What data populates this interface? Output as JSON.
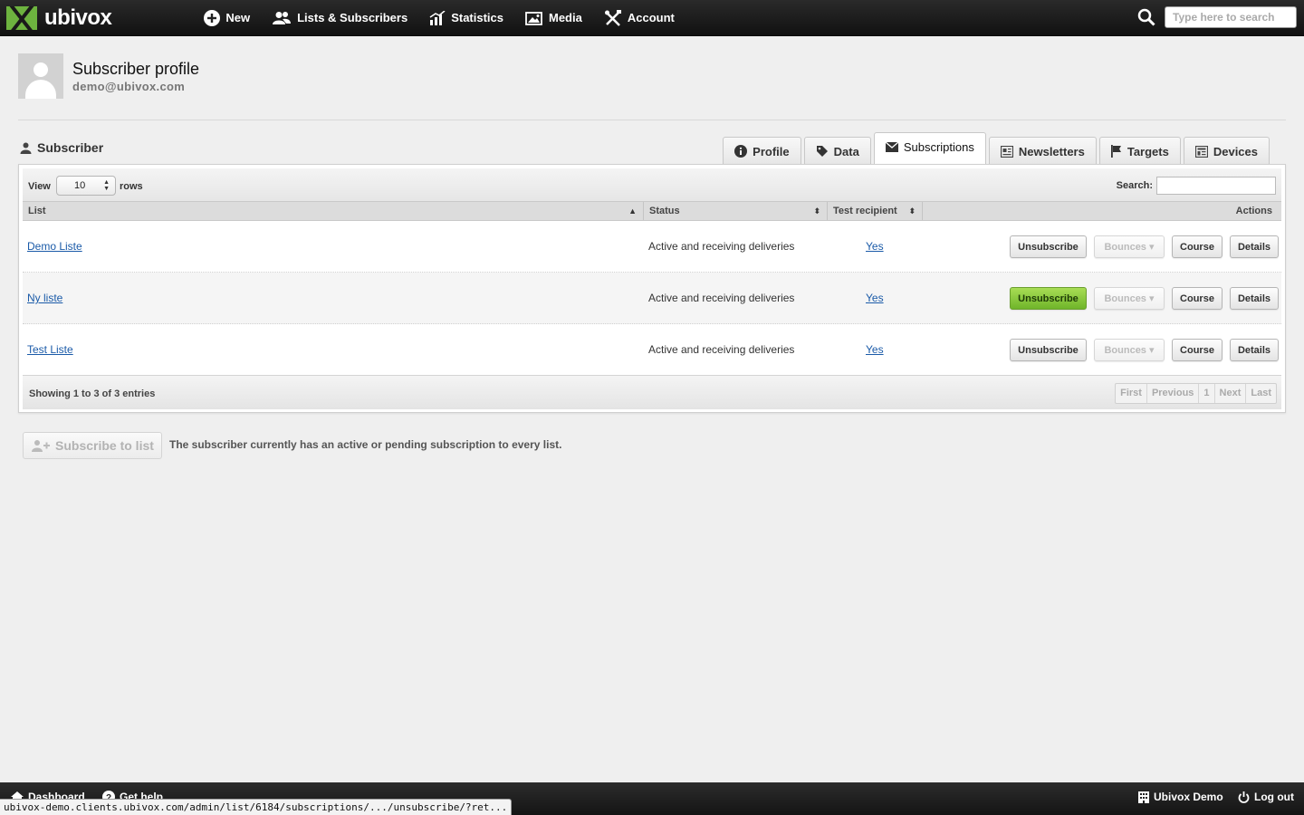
{
  "app": {
    "name": "ubivox"
  },
  "nav": {
    "new": "New",
    "lists": "Lists & Subscribers",
    "statistics": "Statistics",
    "media": "Media",
    "account": "Account"
  },
  "search": {
    "placeholder": "Type here to search"
  },
  "profile": {
    "title": "Subscriber profile",
    "email": "demo@ubivox.com"
  },
  "section": {
    "label": "Subscriber"
  },
  "tabs": [
    "Profile",
    "Data",
    "Subscriptions",
    "Newsletters",
    "Targets",
    "Devices"
  ],
  "active_tab": "Subscriptions",
  "table": {
    "view_label": "View",
    "rows_value": "10",
    "rows_label": "rows",
    "search_label": "Search:",
    "columns": [
      "List",
      "Status",
      "Test recipient",
      "Actions"
    ],
    "rows": [
      {
        "list": "Demo Liste",
        "status": "Active and receiving deliveries",
        "test": "Yes"
      },
      {
        "list": "Ny liste",
        "status": "Active and receiving deliveries",
        "test": "Yes"
      },
      {
        "list": "Test Liste",
        "status": "Active and receiving deliveries",
        "test": "Yes"
      }
    ],
    "actions": {
      "unsubscribe": "Unsubscribe",
      "bounces": "Bounces",
      "course": "Course",
      "details": "Details"
    },
    "info": "Showing 1 to 3 of 3 entries",
    "pager": [
      "First",
      "Previous",
      "1",
      "Next",
      "Last"
    ]
  },
  "subscribe": {
    "button": "Subscribe to list",
    "note": "The subscriber currently has an active or pending subscription to every list."
  },
  "bottom": {
    "dashboard": "Dashboard",
    "help": "Get help",
    "account_name": "Ubivox Demo",
    "logout": "Log out"
  },
  "status_url": "ubivox-demo.clients.ubivox.com/admin/list/6184/subscriptions/.../unsubscribe/?ret...",
  "colors": {
    "brand_green": "#6db33f",
    "hover_green": "#8cc83f",
    "link": "#1a5aa8"
  }
}
